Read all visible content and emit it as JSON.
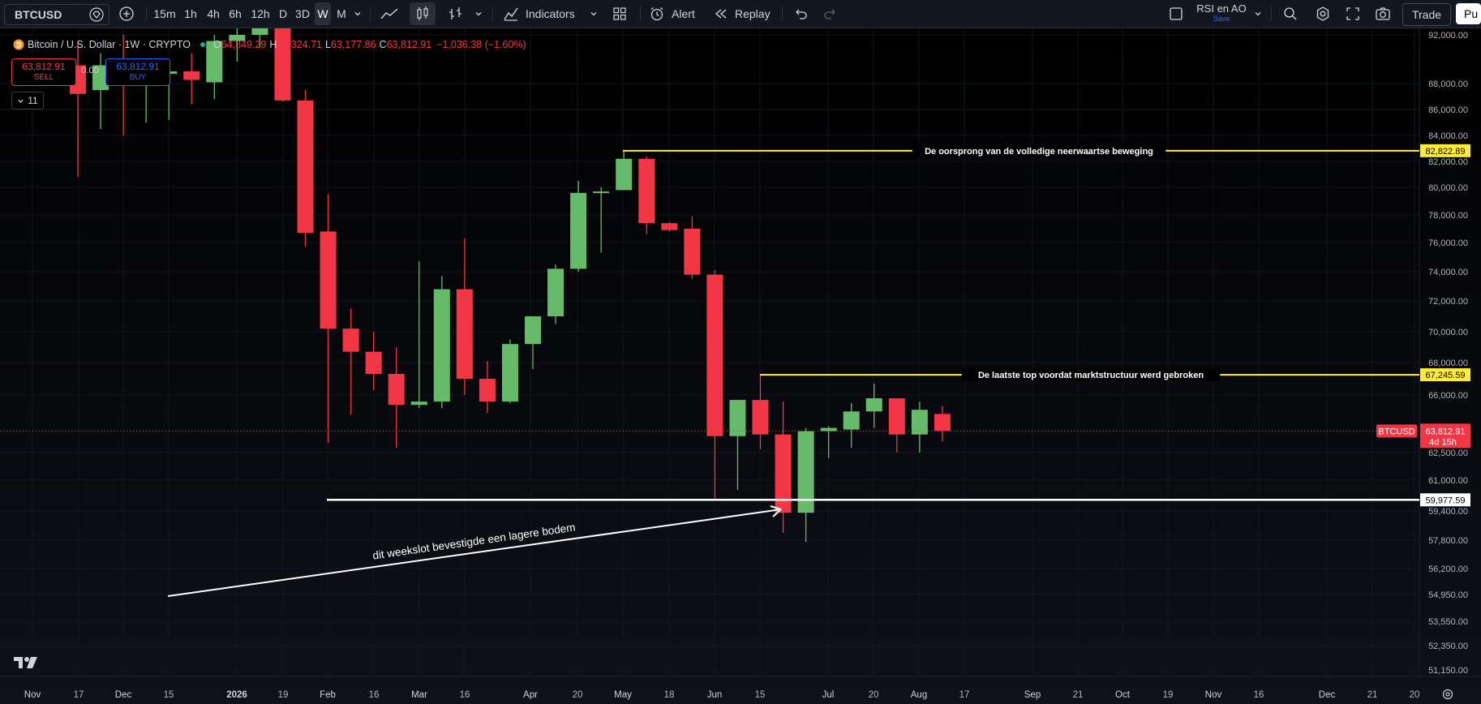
{
  "toolbar": {
    "symbol": "BTCUSD",
    "intervals": [
      "15m",
      "1h",
      "4h",
      "6h",
      "12h",
      "D",
      "3D",
      "W",
      "M"
    ],
    "active_interval": "W",
    "indicators_label": "Indicators",
    "alert_label": "Alert",
    "replay_label": "Replay",
    "layout_name": "RSI en AO",
    "layout_status": "Save",
    "trade_label": "Trade",
    "publish_label": "Pu",
    "icons": [
      "plus-icon",
      "line-chart-icon",
      "candles-icon",
      "bar-chart-icon",
      "indicators-icon",
      "templates-icon",
      "alert-icon",
      "replay-icon",
      "undo-icon",
      "redo-icon",
      "search-icon",
      "settings-icon",
      "fullscreen-icon",
      "camera-icon"
    ]
  },
  "legend": {
    "title": "Bitcoin / U.S. Dollar · 1W · CRYPTO",
    "o_label": "O",
    "o_value": "64,849.29",
    "h_label": "H",
    "h_value": "65,324.71",
    "l_label": "L",
    "l_value": "63,177.86",
    "c_label": "C",
    "c_value": "63,812.91",
    "change": "−1,036.38 (−1.60%)",
    "sell_price": "63,812.91",
    "sell_label": "SELL",
    "spread": "0.00",
    "buy_price": "63,812.91",
    "buy_label": "BUY",
    "layers_count": "11"
  },
  "colors": {
    "up": "#66bb6a",
    "down": "#f23645",
    "yellow": "#ffeb3b",
    "white": "#ffffff",
    "background": "#000000",
    "toolbar": "#131722",
    "text": "#d1d4dc"
  },
  "chart_data": {
    "type": "candlestick",
    "y_axis_labels": [
      "92,000.00",
      "88,000.00",
      "86,000.00",
      "84,000.00",
      "82,000.00",
      "80,000.00",
      "78,000.00",
      "76,000.00",
      "74,000.00",
      "72,000.00",
      "70,000.00",
      "68,000.00",
      "66,000.00",
      "62,500.00",
      "61,000.00",
      "59,400.00",
      "57,800.00",
      "56,200.00",
      "54,950.00",
      "53,550.00",
      "52,350.00",
      "51,150.00"
    ],
    "x_axis_labels": [
      "Nov",
      "17",
      "Dec",
      "15",
      "2026",
      "19",
      "Feb",
      "16",
      "Mar",
      "16",
      "Apr",
      "20",
      "May",
      "18",
      "Jun",
      "15",
      "Jul",
      "20",
      "Aug",
      "17",
      "Sep",
      "21",
      "Oct",
      "19",
      "Nov",
      "16",
      "Dec",
      "21",
      "20"
    ],
    "candles": [
      {
        "o": 89500,
        "h": 91500,
        "l": 80800,
        "c": 87200
      },
      {
        "o": 87500,
        "h": 90500,
        "l": 84500,
        "c": 89500
      },
      {
        "o": 90000,
        "h": 92000,
        "l": 84000,
        "c": 89000
      },
      {
        "o": 88500,
        "h": 89500,
        "l": 85000,
        "c": 88500
      },
      {
        "o": 88800,
        "h": 90000,
        "l": 85200,
        "c": 89000
      },
      {
        "o": 89000,
        "h": 90500,
        "l": 86400,
        "c": 88300
      },
      {
        "o": 88100,
        "h": 92000,
        "l": 86800,
        "c": 91500
      },
      {
        "o": 91500,
        "h": 93000,
        "l": 89800,
        "c": 92000
      },
      {
        "o": 92000,
        "h": 94000,
        "l": 91000,
        "c": 93500
      },
      {
        "o": 94000,
        "h": 95000,
        "l": 86600,
        "c": 86700
      },
      {
        "o": 86700,
        "h": 87500,
        "l": 75700,
        "c": 76700
      },
      {
        "o": 76800,
        "h": 79500,
        "l": 63100,
        "c": 70200
      },
      {
        "o": 70200,
        "h": 71500,
        "l": 64800,
        "c": 68700
      },
      {
        "o": 68700,
        "h": 70000,
        "l": 66300,
        "c": 67300
      },
      {
        "o": 67300,
        "h": 69000,
        "l": 62800,
        "c": 65400
      },
      {
        "o": 65400,
        "h": 74700,
        "l": 65200,
        "c": 65600
      },
      {
        "o": 65600,
        "h": 73700,
        "l": 65200,
        "c": 72800
      },
      {
        "o": 72800,
        "h": 76300,
        "l": 66000,
        "c": 67000
      },
      {
        "o": 67000,
        "h": 68100,
        "l": 64900,
        "c": 65600
      },
      {
        "o": 65600,
        "h": 69500,
        "l": 65500,
        "c": 69200
      },
      {
        "o": 69200,
        "h": 71000,
        "l": 67600,
        "c": 71000
      },
      {
        "o": 71000,
        "h": 74500,
        "l": 70500,
        "c": 74200
      },
      {
        "o": 74200,
        "h": 80500,
        "l": 74000,
        "c": 79600
      },
      {
        "o": 79600,
        "h": 80000,
        "l": 75300,
        "c": 79700
      },
      {
        "o": 79800,
        "h": 82823,
        "l": 79800,
        "c": 82200
      },
      {
        "o": 82200,
        "h": 82400,
        "l": 76600,
        "c": 77400
      },
      {
        "o": 77400,
        "h": 77500,
        "l": 76800,
        "c": 76900
      },
      {
        "o": 77000,
        "h": 77900,
        "l": 73500,
        "c": 73800
      },
      {
        "o": 73800,
        "h": 74100,
        "l": 60000,
        "c": 63500
      },
      {
        "o": 63500,
        "h": 65700,
        "l": 60500,
        "c": 65700
      },
      {
        "o": 65700,
        "h": 67246,
        "l": 62700,
        "c": 63600
      },
      {
        "o": 63600,
        "h": 65600,
        "l": 58200,
        "c": 59300
      },
      {
        "o": 59300,
        "h": 64000,
        "l": 57700,
        "c": 63800
      },
      {
        "o": 63800,
        "h": 64100,
        "l": 62200,
        "c": 64000
      },
      {
        "o": 63900,
        "h": 65500,
        "l": 62800,
        "c": 65000
      },
      {
        "o": 65000,
        "h": 66700,
        "l": 64000,
        "c": 65800
      },
      {
        "o": 65800,
        "h": 65600,
        "l": 62500,
        "c": 63600
      },
      {
        "o": 63600,
        "h": 65600,
        "l": 62500,
        "c": 65100
      },
      {
        "o": 64849.29,
        "h": 65324.71,
        "l": 63177.86,
        "c": 63812.91
      }
    ],
    "current_price": {
      "value": "63,812.91",
      "symbol": "BTCUSD",
      "countdown": "4d 15h"
    },
    "horizontal_levels": [
      {
        "price": 82822.89,
        "label": "82,822.89",
        "text": "De oorsprong van de volledige neerwaartse beweging",
        "color": "#ffeb3b"
      },
      {
        "price": 67245.59,
        "label": "67,245.59",
        "text": "De laatste top voordat marktstructuur werd gebroken",
        "color": "#ffeb3b"
      },
      {
        "price": 59977.59,
        "label": "59,977.59",
        "text": "",
        "color": "#ffffff"
      }
    ],
    "annotation": {
      "text": "dit weekslot bevestigde een lagere bodem",
      "color": "#ffffff"
    }
  }
}
